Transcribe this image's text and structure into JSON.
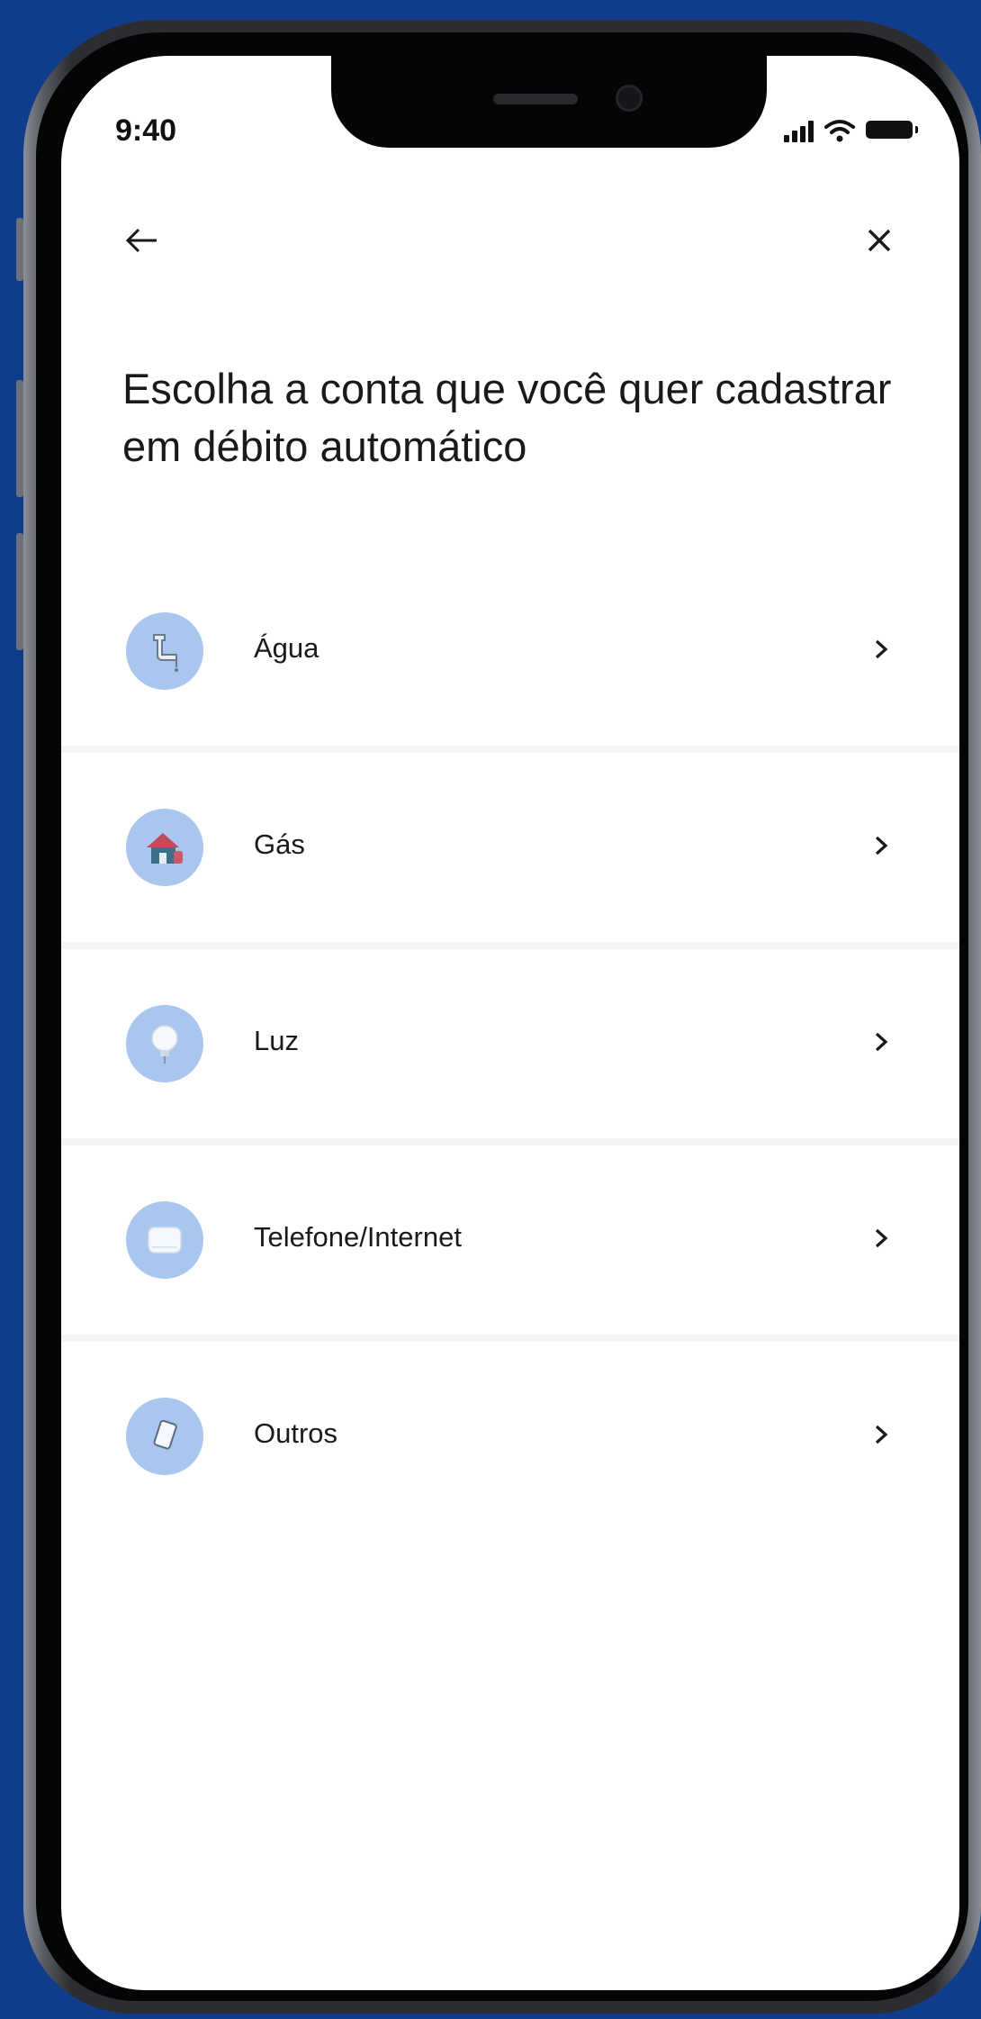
{
  "status_bar": {
    "time": "9:40"
  },
  "nav": {
    "back_icon": "arrow-left-icon",
    "close_icon": "close-icon"
  },
  "title": "Escolha a conta que você quer cadastrar em débito automático",
  "accounts": [
    {
      "label": "Água",
      "icon": "water-faucet-icon"
    },
    {
      "label": "Gás",
      "icon": "gas-house-icon"
    },
    {
      "label": "Luz",
      "icon": "lightbulb-icon"
    },
    {
      "label": "Telefone/Internet",
      "icon": "router-icon"
    },
    {
      "label": "Outros",
      "icon": "document-icon"
    }
  ],
  "colors": {
    "background": "#0f3d8c",
    "icon_circle": "#a9c6ef",
    "separator": "#f4f4f6",
    "text": "#1a1a1a"
  }
}
